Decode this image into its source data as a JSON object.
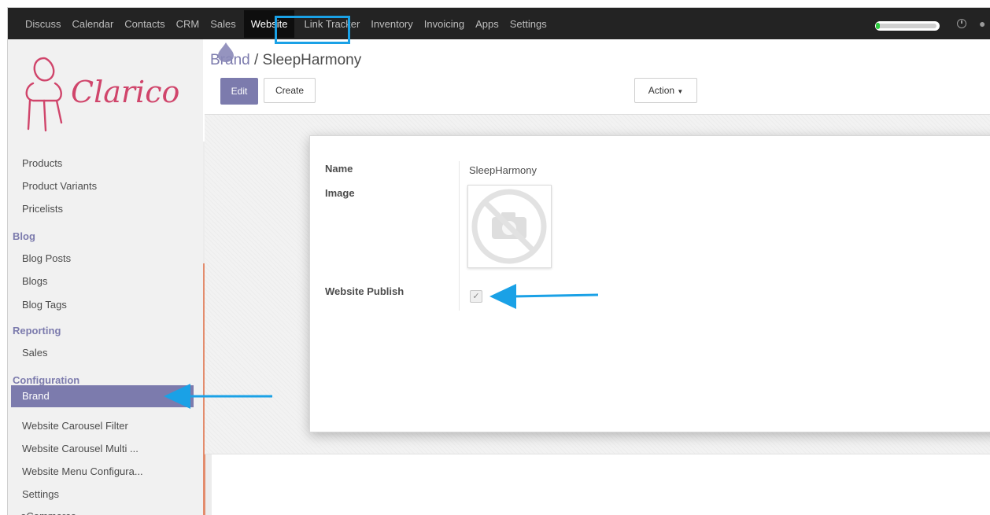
{
  "topbar": {
    "menu": [
      "Discuss",
      "Calendar",
      "Contacts",
      "CRM",
      "Sales",
      "Website",
      "Link Tracker",
      "Inventory",
      "Invoicing",
      "Apps",
      "Settings"
    ],
    "active": "Website"
  },
  "logo": {
    "text": "Clarico",
    "color": "#d0456b"
  },
  "sidebar": {
    "items": [
      "Products",
      "Product Variants",
      "Pricelists"
    ],
    "blog_section": "Blog",
    "blog_items": [
      "Blog Posts",
      "Blogs",
      "Blog Tags"
    ],
    "reporting_section": "Reporting",
    "reporting_items": [
      "Sales"
    ],
    "config_section": "Configuration",
    "config_active": "Brand",
    "config_items": [
      "Website Carousel Filter",
      "Website Carousel Multi ...",
      "Website Menu Configura...",
      "Settings"
    ],
    "ecommerce": "eCommerce"
  },
  "breadcrumb": {
    "parent": "Brand",
    "separator": "/",
    "current": "SleepHarmony"
  },
  "buttons": {
    "edit": "Edit",
    "create": "Create",
    "action": "Action"
  },
  "form": {
    "name_label": "Name",
    "name_value": "SleepHarmony",
    "image_label": "Image",
    "publish_label": "Website Publish",
    "publish_checked": true
  },
  "colors": {
    "accent": "#7c7bad",
    "annotation": "#1aa1e6",
    "topbar": "#232323"
  },
  "icons": {
    "clock": "clock-icon",
    "gear": "gear-icon",
    "caret": "caret-down-icon",
    "checkbox": "checkbox-icon",
    "no_image": "no-camera-icon"
  }
}
